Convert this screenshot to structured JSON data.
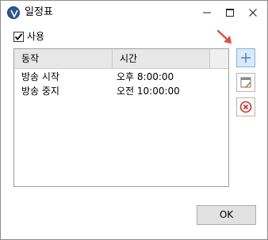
{
  "window": {
    "title": "일정표"
  },
  "checkbox": {
    "label": "사용",
    "checked": true
  },
  "list": {
    "columns": [
      "동작",
      "시간"
    ],
    "rows": [
      {
        "action": "방송 시작",
        "time": "오후 8:00:00"
      },
      {
        "action": "방송 중지",
        "time": "오전 10:00:00"
      }
    ]
  },
  "buttons": {
    "ok_label": "OK"
  },
  "colors": {
    "arrow": "#e84d3d",
    "delete": "#d9302c",
    "add_accent": "#3a7bd5"
  }
}
